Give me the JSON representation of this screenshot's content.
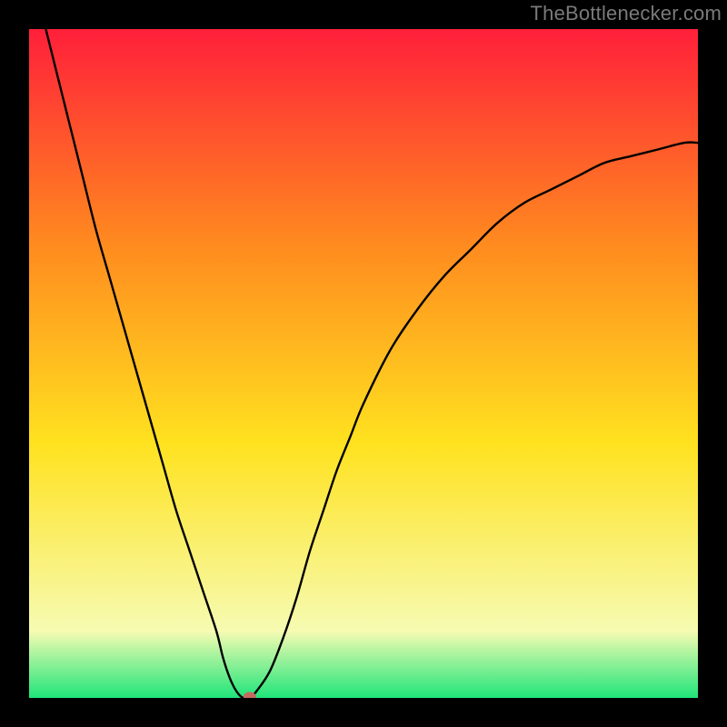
{
  "attribution": {
    "text": "TheBottlenecker.com"
  },
  "chart_data": {
    "type": "line",
    "title": "",
    "xlabel": "",
    "ylabel": "",
    "xlim": [
      0,
      100
    ],
    "ylim": [
      0,
      100
    ],
    "gradient_colors": {
      "top": "#ff1f3a",
      "mid_upper": "#ff8a1f",
      "mid_lower": "#ffe21f",
      "near_bottom": "#f6fbb2",
      "bottom": "#1fe57a"
    },
    "series": [
      {
        "name": "bottleneck-curve",
        "x": [
          0,
          2,
          4,
          6,
          8,
          10,
          12,
          14,
          16,
          18,
          20,
          22,
          24,
          26,
          28,
          29,
          30,
          31,
          32,
          33,
          34,
          36,
          38,
          40,
          42,
          44,
          46,
          48,
          50,
          54,
          58,
          62,
          66,
          70,
          74,
          78,
          82,
          86,
          90,
          94,
          98,
          100
        ],
        "values": [
          110,
          102,
          94,
          86,
          78,
          70,
          63,
          56,
          49,
          42,
          35,
          28,
          22,
          16,
          10,
          6,
          3,
          1,
          0,
          0,
          1,
          4,
          9,
          15,
          22,
          28,
          34,
          39,
          44,
          52,
          58,
          63,
          67,
          71,
          74,
          76,
          78,
          80,
          81,
          82,
          83,
          83
        ]
      }
    ],
    "marker": {
      "x": 33,
      "y": 0.2,
      "color": "#c46a5e"
    }
  }
}
